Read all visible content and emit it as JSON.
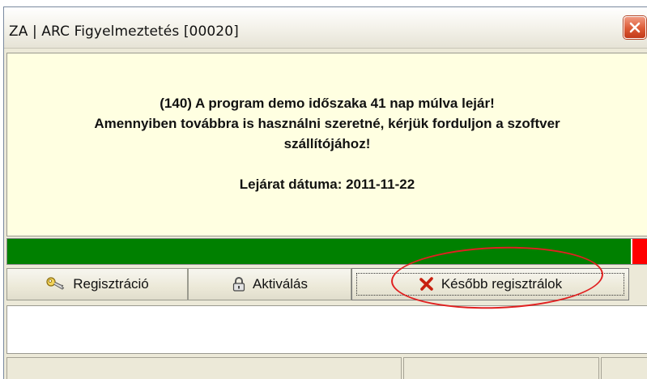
{
  "window": {
    "title": "ZA | ARC Figyelmeztetés [00020]"
  },
  "message": {
    "line1": "(140) A program demo időszaka 41 nap múlva lejár!",
    "line2": "Amennyiben továbbra is használni szeretné, kérjük forduljon a szoftver",
    "line3": "szállítójához!",
    "expiry": "Lejárat dátuma: 2011-11-22"
  },
  "progress": {
    "fraction": 0.975,
    "fill_color": "#008000",
    "end_color": "#ff0000"
  },
  "buttons": {
    "register": "Regisztráció",
    "activate": "Aktiválás",
    "later": "Később regisztrálok"
  },
  "icons": {
    "register": "key-icon",
    "activate": "padlock-icon",
    "later": "red-x-icon",
    "close": "close-icon"
  },
  "annotation_color": "#e02020"
}
